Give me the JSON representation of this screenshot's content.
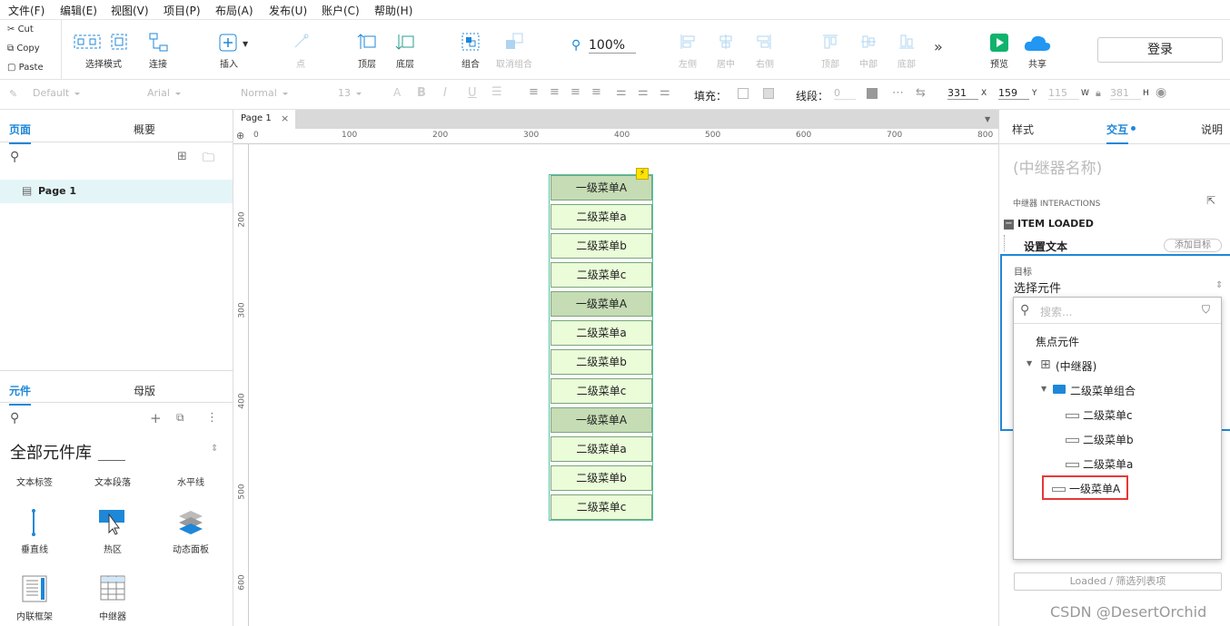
{
  "menu": [
    "文件(F)",
    "编辑(E)",
    "视图(V)",
    "项目(P)",
    "布局(A)",
    "发布(U)",
    "账户(C)",
    "帮助(H)"
  ],
  "clipboard": {
    "cut": "Cut",
    "copy": "Copy",
    "paste": "Paste"
  },
  "toolbar": {
    "select_mode": "选择模式",
    "connect": "连接",
    "insert": "插入",
    "point": "点",
    "top_layer": "顶层",
    "bottom_layer": "底层",
    "group": "组合",
    "ungroup": "取消组合",
    "zoom": "100%",
    "align_left": "左侧",
    "align_center": "居中",
    "align_right": "右侧",
    "align_top": "顶部",
    "align_middle": "中部",
    "align_bottom": "底部",
    "preview": "预览",
    "share": "共享",
    "login": "登录"
  },
  "format": {
    "style": "Default",
    "font": "Arial",
    "weight": "Normal",
    "size": "13",
    "fill_label": "填充：",
    "stroke_label": "线段：",
    "stroke_value": "0",
    "x": "331",
    "x_label": "X",
    "y": "159",
    "y_label": "Y",
    "w": "115",
    "w_label": "W",
    "h": "381",
    "h_label": "H"
  },
  "left_top": {
    "tab_pages": "页面",
    "tab_outline": "概要",
    "page_item": "Page 1"
  },
  "left_bottom": {
    "tab_widgets": "元件",
    "tab_masters": "母版",
    "library": "全部元件库",
    "widgets": [
      "文本标签",
      "文本段落",
      "水平线",
      "垂直线",
      "热区",
      "动态面板",
      "内联框架",
      "中继器"
    ]
  },
  "canvas": {
    "doc_tab": "Page 1",
    "ruler_h": [
      "0",
      "100",
      "200",
      "300",
      "400",
      "500",
      "600",
      "700",
      "800"
    ],
    "ruler_v": [
      "200",
      "300",
      "400",
      "500",
      "600"
    ],
    "rows": [
      {
        "label": "一级菜单A",
        "level": 1
      },
      {
        "label": "二级菜单a",
        "level": 2
      },
      {
        "label": "二级菜单b",
        "level": 2
      },
      {
        "label": "二级菜单c",
        "level": 2
      },
      {
        "label": "一级菜单A",
        "level": 1
      },
      {
        "label": "二级菜单a",
        "level": 2
      },
      {
        "label": "二级菜单b",
        "level": 2
      },
      {
        "label": "二级菜单c",
        "level": 2
      },
      {
        "label": "一级菜单A",
        "level": 1
      },
      {
        "label": "二级菜单a",
        "level": 2
      },
      {
        "label": "二级菜单b",
        "level": 2
      },
      {
        "label": "二级菜单c",
        "level": 2
      }
    ]
  },
  "right": {
    "tab_style": "样式",
    "tab_interact": "交互",
    "tab_notes": "说明",
    "repeater_name": "(中继器名称)",
    "interactions_title": "中继器 INTERACTIONS",
    "event": "ITEM LOADED",
    "action": "设置文本",
    "add_target": "添加目标",
    "target_label": "目标",
    "target_value": "选择元件",
    "search_placeholder": "搜索...",
    "tree": {
      "focus": "焦点元件",
      "repeater": "(中继器)",
      "group": "二级菜单组合",
      "items": [
        "二级菜单c",
        "二级菜单b",
        "二级菜单a",
        "一级菜单A"
      ]
    },
    "footer_btn": "Loaded / 筛选列表项",
    "watermark": "CSDN @DesertOrchid"
  },
  "colors": {
    "accent": "#1e87d8",
    "level1": "#c5dcb4",
    "level2": "#eafcd8",
    "highlight": "#e53935"
  }
}
